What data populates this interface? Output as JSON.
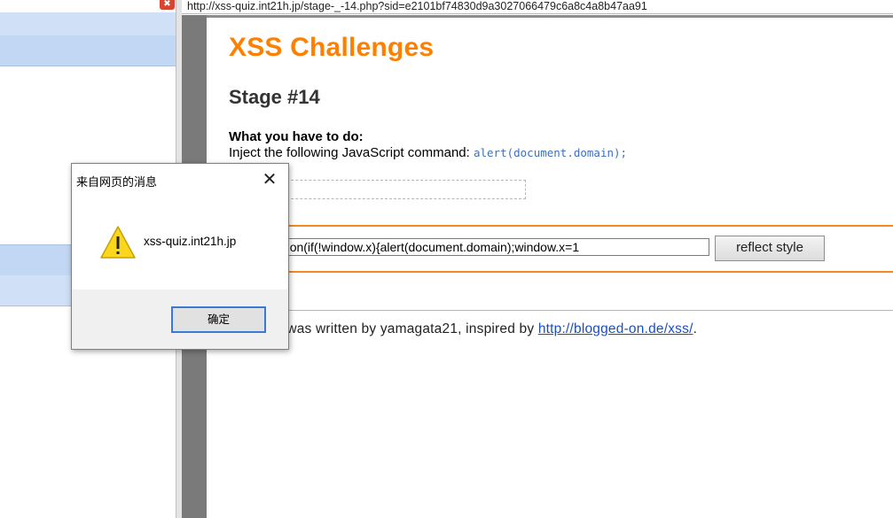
{
  "browser": {
    "url": "http://xss-quiz.int21h.jp/stage-_-14.php?sid=e2101bf74830d9a3027066479c6a8c4a8b47aa91",
    "close_glyph": "✖"
  },
  "page": {
    "site_title": "XSS Challenges",
    "stage_title": "Stage #14",
    "task_heading": "What you have to do:",
    "task_text": "Inject the following JavaScript command: ",
    "task_code": "alert(document.domain);",
    "payload_value": "xss:expres/**/sion(if(!window.x){alert(document.domain);window.x=1",
    "reflect_button": "reflect style",
    "footer_prefix": "e was written by yamagata21, inspired by ",
    "footer_link": "http://blogged-on.de/xss/",
    "footer_suffix": "."
  },
  "dialog": {
    "title": "来自网页的消息",
    "close_glyph": "✕",
    "message": "xss-quiz.int21h.jp",
    "ok_label": "确定",
    "icon": "warning-icon"
  },
  "colors": {
    "title_orange": "#ff8000",
    "rule_orange": "#f28a1e",
    "code_blue": "#3c6fbd",
    "link_blue": "#1a4fc3",
    "panel_blue": "#c2d7f3"
  }
}
